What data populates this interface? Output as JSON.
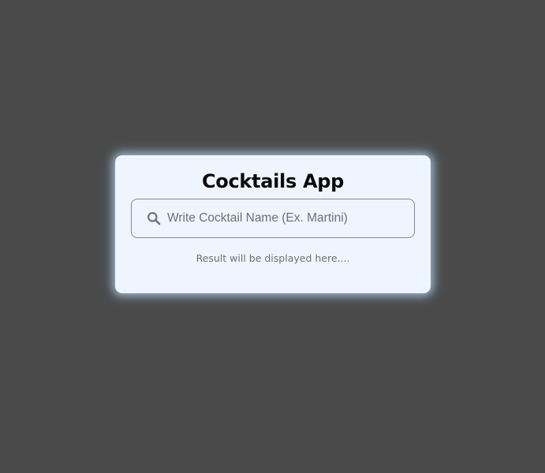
{
  "app": {
    "title": "Cocktails App"
  },
  "search": {
    "placeholder": "Write Cocktail Name (Ex. Martini)",
    "value": "",
    "icon": "search-icon"
  },
  "result": {
    "message": "Result will be displayed here...."
  },
  "colors": {
    "background": "#4a4a4a",
    "card": "#eef5ff",
    "glow": "#bee1ff",
    "title": "#0b0b0b"
  }
}
